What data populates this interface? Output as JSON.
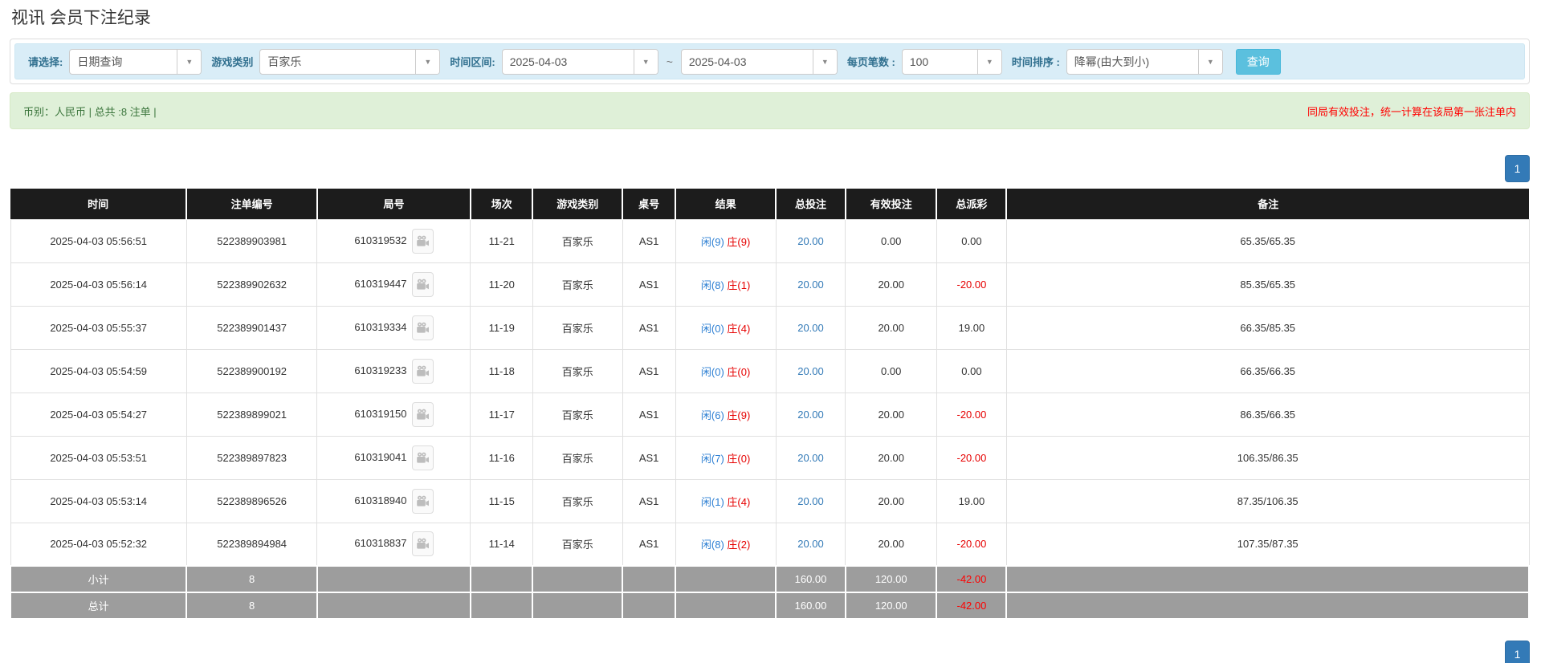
{
  "page": {
    "title": "视讯 会员下注纪录"
  },
  "filters": {
    "select_label": "请选择:",
    "select_value": "日期查询",
    "game_category_label": "游戏类别",
    "game_category_value": "百家乐",
    "time_range_label": "时间区间:",
    "date_from": "2025-04-03",
    "date_separator": "~",
    "date_to": "2025-04-03",
    "page_size_label": "每页笔数 :",
    "page_size_value": "100",
    "time_sort_label": "时间排序 :",
    "time_sort_value": "降幂(由大到小)",
    "search_button": "查询",
    "caret": "▼"
  },
  "notice_bar": {
    "left_text": "币别：人民币 | 总共 :8 注单 |",
    "right_notice": "同局有效投注，统一计算在该局第一张注单内"
  },
  "pagination": {
    "page": "1"
  },
  "table": {
    "headers": [
      "时间",
      "注单编号",
      "局号",
      "场次",
      "游戏类别",
      "桌号",
      "结果",
      "总投注",
      "有效投注",
      "总派彩",
      "备注"
    ],
    "rows": [
      {
        "time": "2025-04-03 05:56:51",
        "bet_id": "522389903981",
        "round_id": "610319532",
        "session": "11-21",
        "game": "百家乐",
        "table_name": "AS1",
        "result_player": "闲(9)",
        "result_banker": "庄(9)",
        "total_bet": "20.00",
        "valid_bet": "0.00",
        "payout": "0.00",
        "remark": "65.35/65.35"
      },
      {
        "time": "2025-04-03 05:56:14",
        "bet_id": "522389902632",
        "round_id": "610319447",
        "session": "11-20",
        "game": "百家乐",
        "table_name": "AS1",
        "result_player": "闲(8)",
        "result_banker": "庄(1)",
        "total_bet": "20.00",
        "valid_bet": "20.00",
        "payout": "-20.00",
        "remark": "85.35/65.35"
      },
      {
        "time": "2025-04-03 05:55:37",
        "bet_id": "522389901437",
        "round_id": "610319334",
        "session": "11-19",
        "game": "百家乐",
        "table_name": "AS1",
        "result_player": "闲(0)",
        "result_banker": "庄(4)",
        "total_bet": "20.00",
        "valid_bet": "20.00",
        "payout": "19.00",
        "remark": "66.35/85.35"
      },
      {
        "time": "2025-04-03 05:54:59",
        "bet_id": "522389900192",
        "round_id": "610319233",
        "session": "11-18",
        "game": "百家乐",
        "table_name": "AS1",
        "result_player": "闲(0)",
        "result_banker": "庄(0)",
        "total_bet": "20.00",
        "valid_bet": "0.00",
        "payout": "0.00",
        "remark": "66.35/66.35"
      },
      {
        "time": "2025-04-03 05:54:27",
        "bet_id": "522389899021",
        "round_id": "610319150",
        "session": "11-17",
        "game": "百家乐",
        "table_name": "AS1",
        "result_player": "闲(6)",
        "result_banker": "庄(9)",
        "total_bet": "20.00",
        "valid_bet": "20.00",
        "payout": "-20.00",
        "remark": "86.35/66.35"
      },
      {
        "time": "2025-04-03 05:53:51",
        "bet_id": "522389897823",
        "round_id": "610319041",
        "session": "11-16",
        "game": "百家乐",
        "table_name": "AS1",
        "result_player": "闲(7)",
        "result_banker": "庄(0)",
        "total_bet": "20.00",
        "valid_bet": "20.00",
        "payout": "-20.00",
        "remark": "106.35/86.35"
      },
      {
        "time": "2025-04-03 05:53:14",
        "bet_id": "522389896526",
        "round_id": "610318940",
        "session": "11-15",
        "game": "百家乐",
        "table_name": "AS1",
        "result_player": "闲(1)",
        "result_banker": "庄(4)",
        "total_bet": "20.00",
        "valid_bet": "20.00",
        "payout": "19.00",
        "remark": "87.35/106.35"
      },
      {
        "time": "2025-04-03 05:52:32",
        "bet_id": "522389894984",
        "round_id": "610318837",
        "session": "11-14",
        "game": "百家乐",
        "table_name": "AS1",
        "result_player": "闲(8)",
        "result_banker": "庄(2)",
        "total_bet": "20.00",
        "valid_bet": "20.00",
        "payout": "-20.00",
        "remark": "107.35/87.35"
      }
    ],
    "subtotal": {
      "label": "小计",
      "count": "8",
      "total_bet": "160.00",
      "valid_bet": "120.00",
      "payout": "-42.00",
      "remark": ""
    },
    "total": {
      "label": "总计",
      "count": "8",
      "total_bet": "160.00",
      "valid_bet": "120.00",
      "payout": "-42.00",
      "remark": ""
    }
  },
  "colors": {
    "accent_blue": "#337ab7",
    "search_button_blue": "#5bc0de",
    "filter_bar_bg": "#d9edf7",
    "filter_label_blue": "#31708f",
    "notice_bar_bg": "#dff0d8",
    "notice_green_text": "#3c763d",
    "notice_red_text": "#ff0000",
    "negative_red": "#e60000",
    "player_blue": "#2d7fd3",
    "banker_red": "#e60000",
    "table_header_bg": "#1c1c1c",
    "summary_row_bg": "#9d9d9d"
  }
}
